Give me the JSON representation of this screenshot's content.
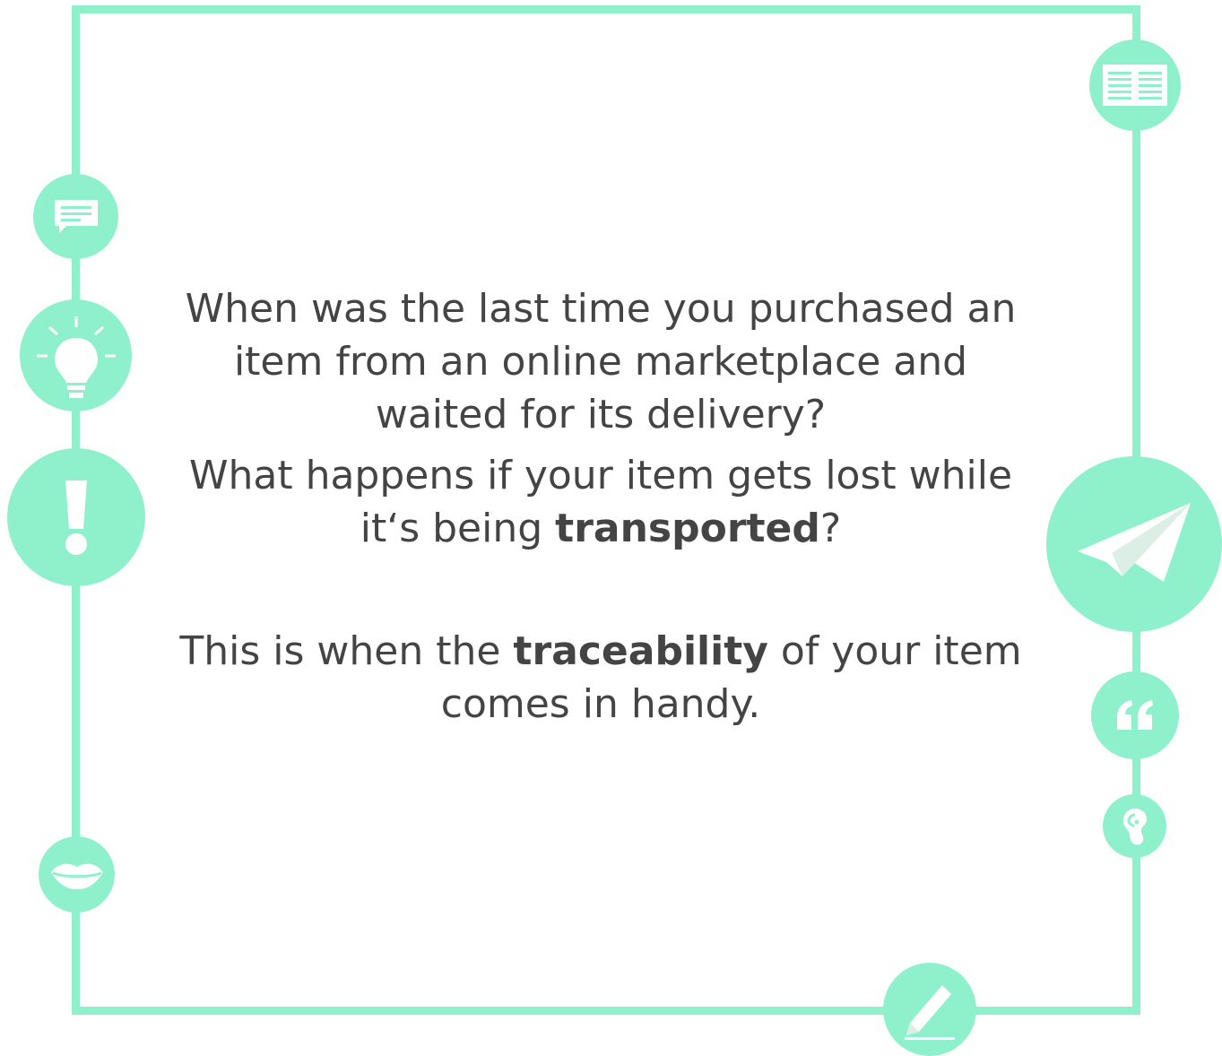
{
  "colors": {
    "accent": "#8ff0cc",
    "icon": "#ffffff",
    "text": "#444444"
  },
  "content": {
    "question_1": "When was the last time you purchased an item from an online marketplace and waited for its delivery?",
    "question_2_lead": "What happens if your item gets lost while it‘s being ",
    "question_2_emphasis": "transported",
    "question_2_tail": "?",
    "statement_lead": "This is when the ",
    "statement_emphasis": "traceability",
    "statement_tail": " of your item comes in handy."
  },
  "icons": [
    "newspaper-icon",
    "speech-bubble-icon",
    "lightbulb-icon",
    "exclamation-icon",
    "paper-plane-icon",
    "quote-icon",
    "ear-icon",
    "lips-icon",
    "pencil-icon"
  ]
}
